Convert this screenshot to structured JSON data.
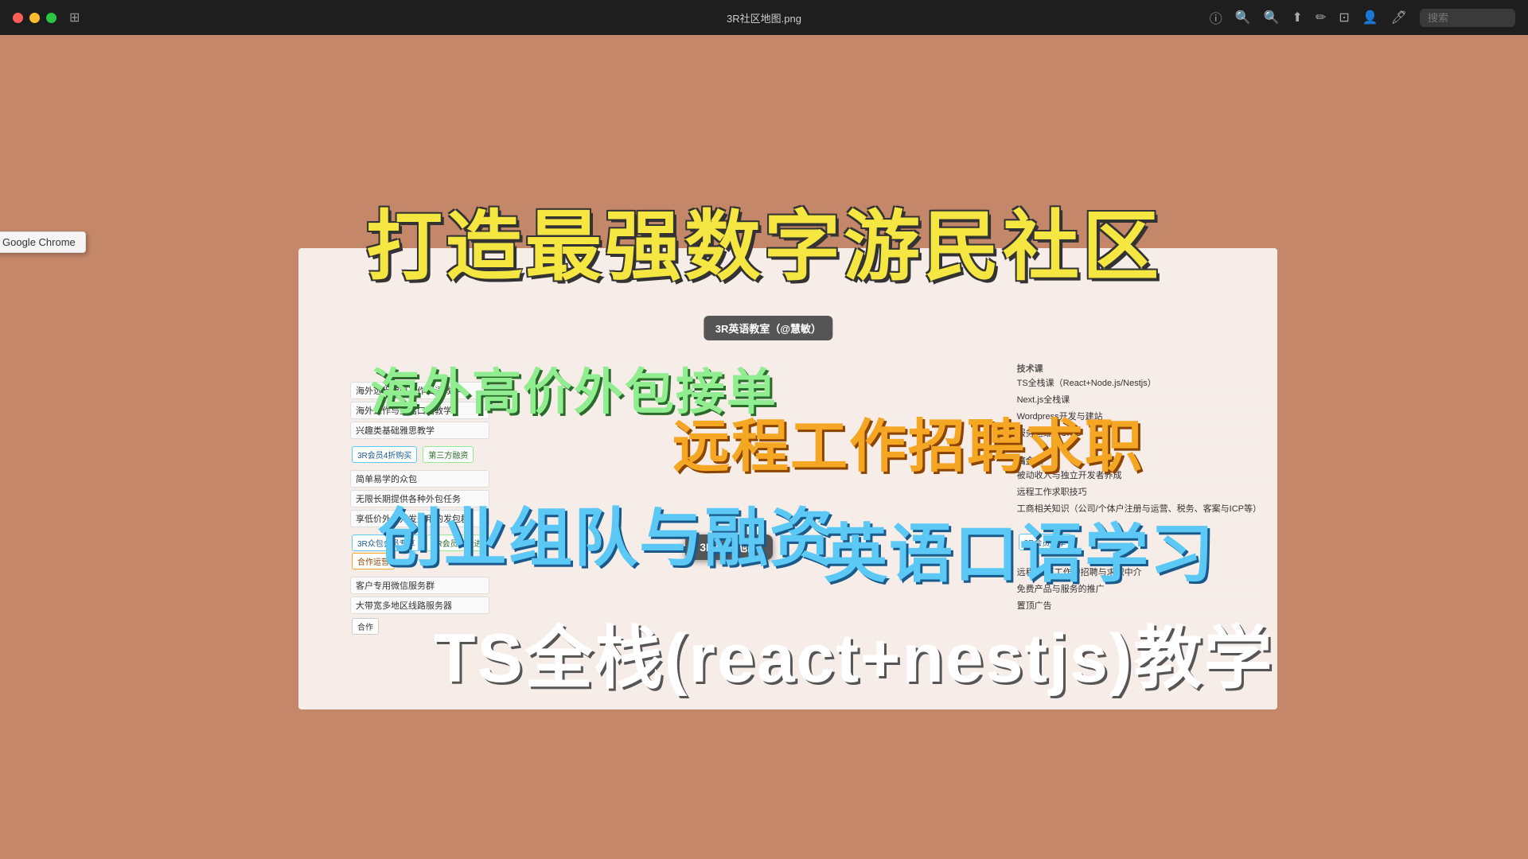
{
  "titlebar": {
    "filename": "3R社区地图.png",
    "search_placeholder": "搜索"
  },
  "badge": {
    "label": "Google Chrome"
  },
  "overlay": {
    "title": "打造最强数字游民社区",
    "text1": "海外高价外包接单",
    "text2": "远程工作招聘求职",
    "text3": "创业组队与融资",
    "text4": "英语口语学习",
    "text5": "TS全栈(react+nestjs)教学"
  },
  "mindmap": {
    "center": "3R社区地图",
    "left_items": [
      "海外远程编码工作口语教学",
      "海外工作与生活口语教学",
      "兴趣类基础雅思教学",
      "简单易学的众包",
      "无限长期提供各种外包任务",
      "享低价外包开发费用的发包群",
      "客户专用微信服务群",
      "大带宽多地区线路服务器"
    ],
    "right_section1_title": "技术课",
    "right_items1": [
      "TS全栈课（React+Node.js/Nestjs）",
      "Next.js全栈课",
      "Wordpress开发与建站",
      "服务运维与CICD"
    ],
    "right_section2_title": "搞金课",
    "right_items2": [
      "被动收入与独立开发者养成",
      "远程工作求职技巧",
      "工商相关知识（公司/个体户注册与运营、税务、客案与ICP等）"
    ],
    "bottom_items": [
      "远程/坐班工作的招聘与求职中介",
      "免费产品与服务的推广",
      "置顶广告"
    ],
    "membership_items": [
      "3R众包会员专享",
      "3R会员免费进",
      "合作运营",
      "3R会员独享"
    ],
    "center_node_label": "3R英语教室（@慧敏）",
    "tabs": [
      "3R会员4折购买",
      "第三方融资"
    ]
  }
}
